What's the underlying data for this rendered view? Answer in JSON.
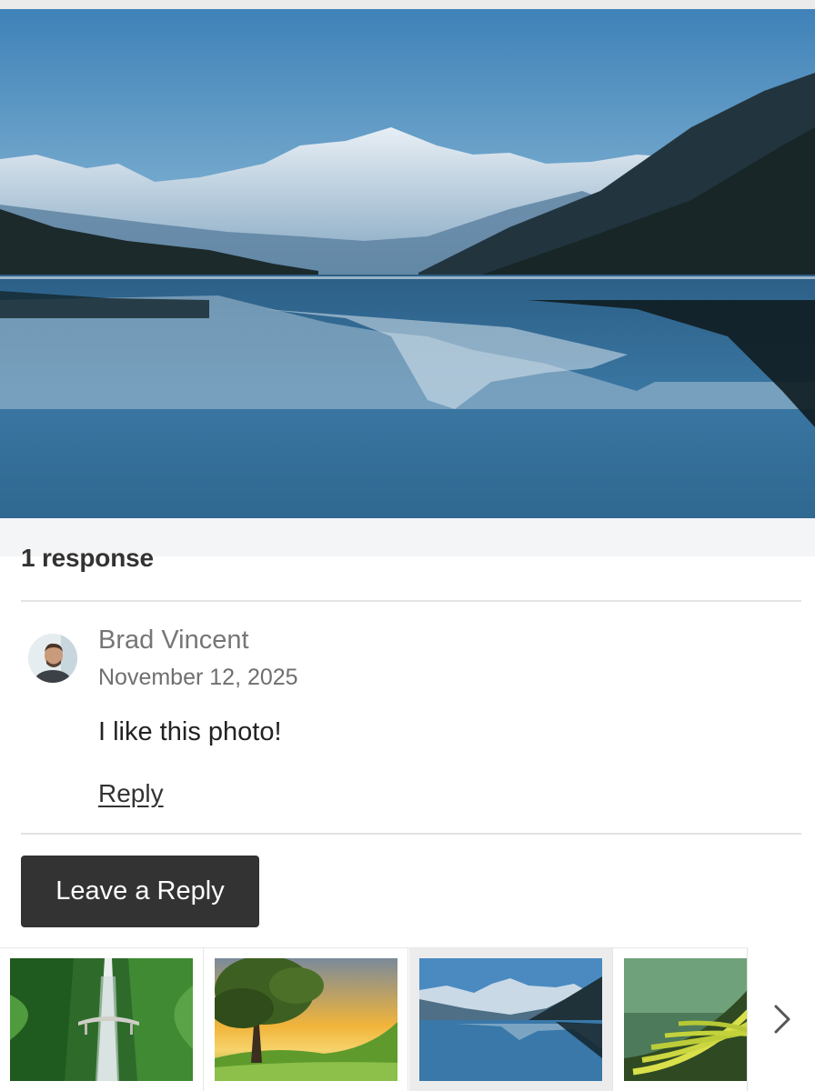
{
  "hero": {
    "image": "mountain-lake-landscape"
  },
  "comments": {
    "title": "1 response",
    "items": [
      {
        "author": "Brad Vincent",
        "date": "November 12, 2025",
        "text": "I like this photo!",
        "reply_label": "Reply"
      }
    ]
  },
  "leave_reply_label": "Leave a Reply",
  "thumbnails": [
    {
      "image": "waterfall-bridge",
      "active": false
    },
    {
      "image": "sunset-tree-hills",
      "active": false
    },
    {
      "image": "mountain-lake",
      "active": true
    },
    {
      "image": "rice-terraces",
      "active": false
    }
  ],
  "icons": {
    "next": "chevron-right-icon"
  },
  "colors": {
    "button_bg": "#333333",
    "button_text": "#ffffff",
    "divider": "#e3e3e3"
  }
}
